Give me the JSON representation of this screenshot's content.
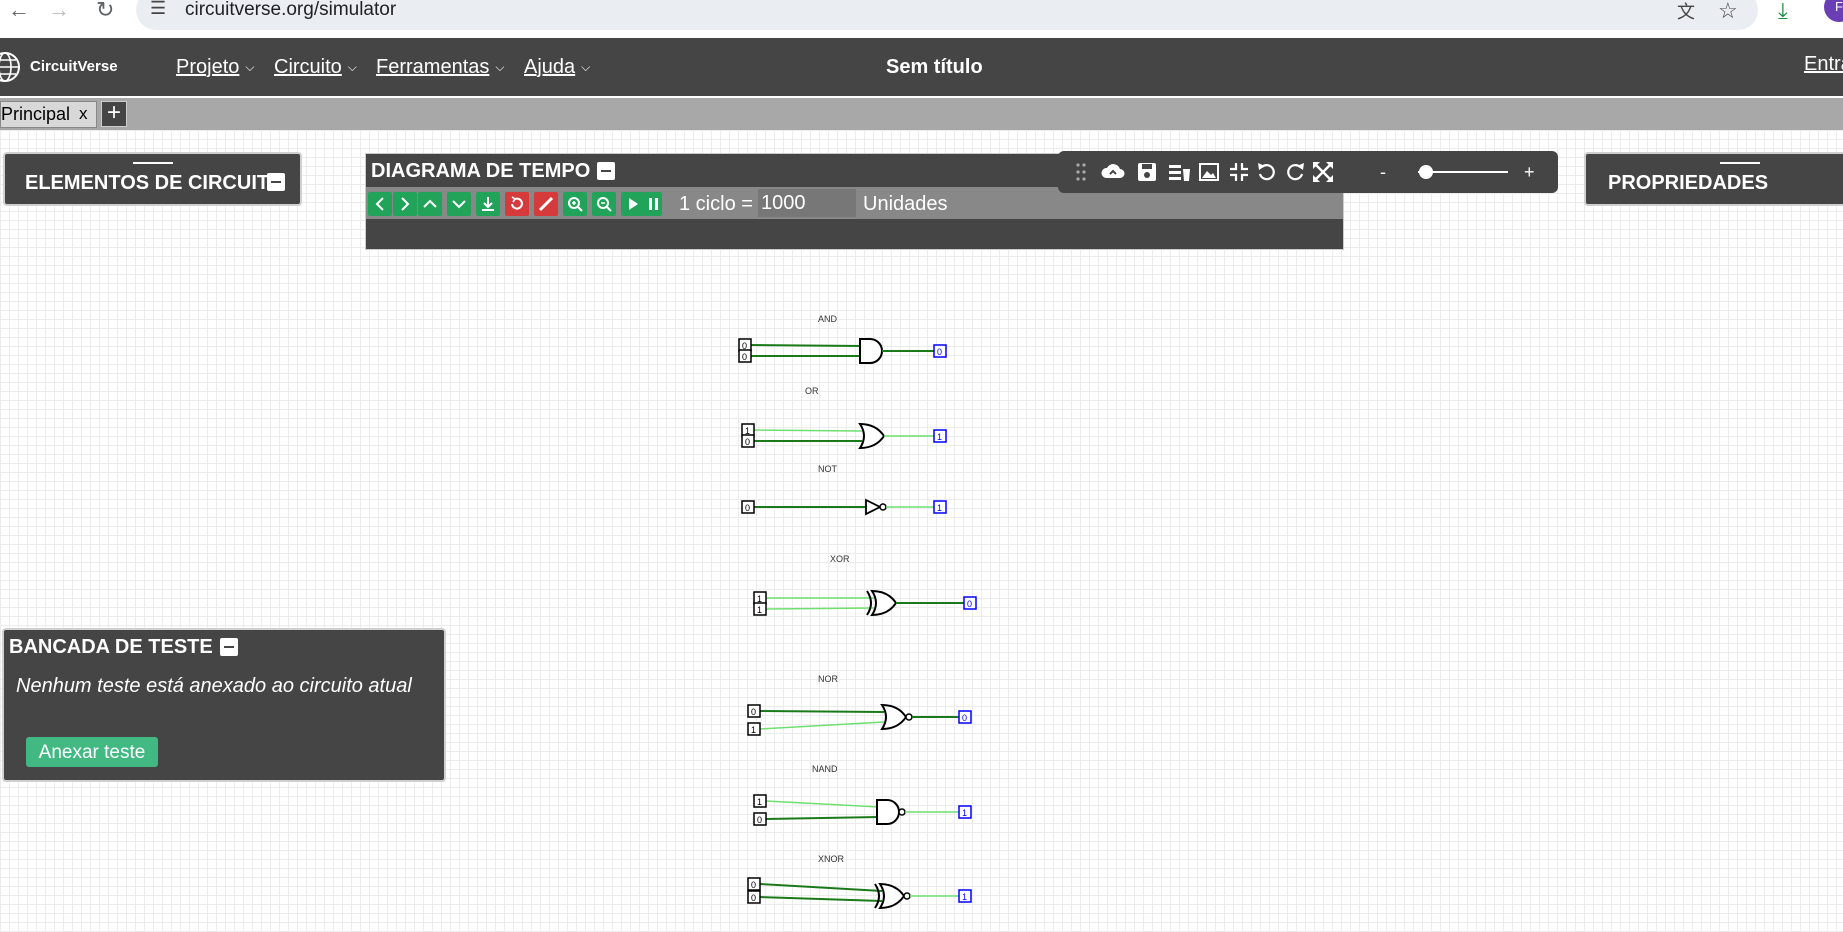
{
  "browser": {
    "url": "circuitverse.org/simulator",
    "avatar_initial": "F"
  },
  "app": {
    "logo_text": "CircuitVerse",
    "menus": [
      {
        "label": "Projeto"
      },
      {
        "label": "Circuito"
      },
      {
        "label": "Ferramentas"
      },
      {
        "label": "Ajuda"
      }
    ],
    "project_title": "Sem título",
    "login_label": "Entra"
  },
  "tabs": {
    "items": [
      {
        "label": "Principal",
        "close": "x"
      }
    ],
    "add_label": "+"
  },
  "panels": {
    "elements_title": "ELEMENTOS DE CIRCUITO",
    "properties_title": "PROPRIEDADES",
    "timing": {
      "title": "DIAGRAMA DE TEMPO",
      "cycle_label": "1 ciclo =",
      "cycle_value": "1000",
      "units_label": "Unidades"
    },
    "test_bench": {
      "title": "BANCADA DE TESTE",
      "message": "Nenhum teste está anexado ao circuito atual",
      "attach_button": "Anexar teste"
    }
  },
  "zoom": {
    "minus": "-",
    "plus": "+",
    "level": 0.05
  },
  "colors": {
    "navbar": "#454545",
    "tabbar": "#a8a8a8",
    "accent_green": "#42b983",
    "wire_dark": "#1a7a1a",
    "wire_light": "#6fe06f",
    "output_blue": "#0000ff"
  },
  "icons": {
    "qa": [
      "drag-handle-icon",
      "cloud-upload-icon",
      "save-icon",
      "delete-icon",
      "image-icon",
      "fit-screen-icon",
      "undo-icon",
      "redo-icon",
      "fullscreen-icon"
    ]
  },
  "circuit": {
    "gates": [
      {
        "label": "AND",
        "inputs": [
          "0",
          "0"
        ],
        "output": "0"
      },
      {
        "label": "OR",
        "inputs": [
          "1",
          "0"
        ],
        "output": "1"
      },
      {
        "label": "NOT",
        "inputs": [
          "0"
        ],
        "output": "1"
      },
      {
        "label": "XOR",
        "inputs": [
          "1",
          "1"
        ],
        "output": "0"
      },
      {
        "label": "NOR",
        "inputs": [
          "0",
          "1"
        ],
        "output": "0"
      },
      {
        "label": "NAND",
        "inputs": [
          "1",
          "0"
        ],
        "output": "1"
      },
      {
        "label": "XNOR",
        "inputs": [
          "0",
          "0"
        ],
        "output": "1"
      }
    ]
  }
}
